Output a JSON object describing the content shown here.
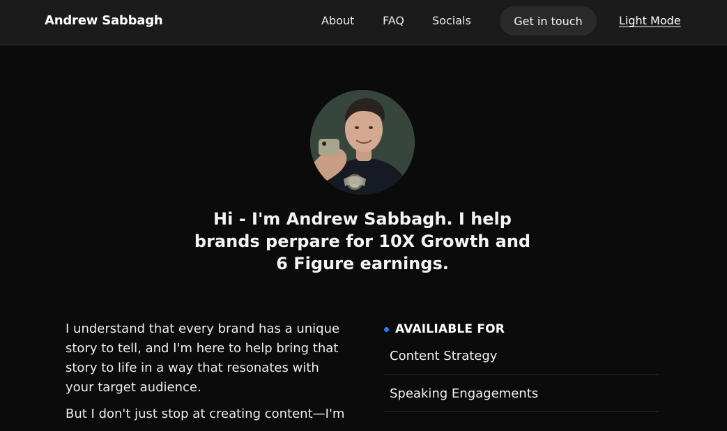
{
  "nav": {
    "brand": "Andrew Sabbagh",
    "links": [
      "About",
      "FAQ",
      "Socials"
    ],
    "cta": "Get in touch",
    "mode_toggle": "Light Mode"
  },
  "hero": {
    "headline": "Hi - I'm Andrew Sabbagh. I help brands perpare for 10X Growth and 6 Figure earnings."
  },
  "body": {
    "paragraphs": [
      "I understand that every brand has a unique story to tell, and I'm here to help bring that story to life in a way that resonates with your target audience.",
      "But I don't just stop at creating content—I'm"
    ]
  },
  "available_for": {
    "title": "AVAILIABLE FOR",
    "items": [
      "Content Strategy",
      "Speaking Engagements"
    ]
  },
  "colors": {
    "background": "#0b0b0b",
    "navbar": "#1b1b1b",
    "accent_dot": "#1e7bff"
  }
}
